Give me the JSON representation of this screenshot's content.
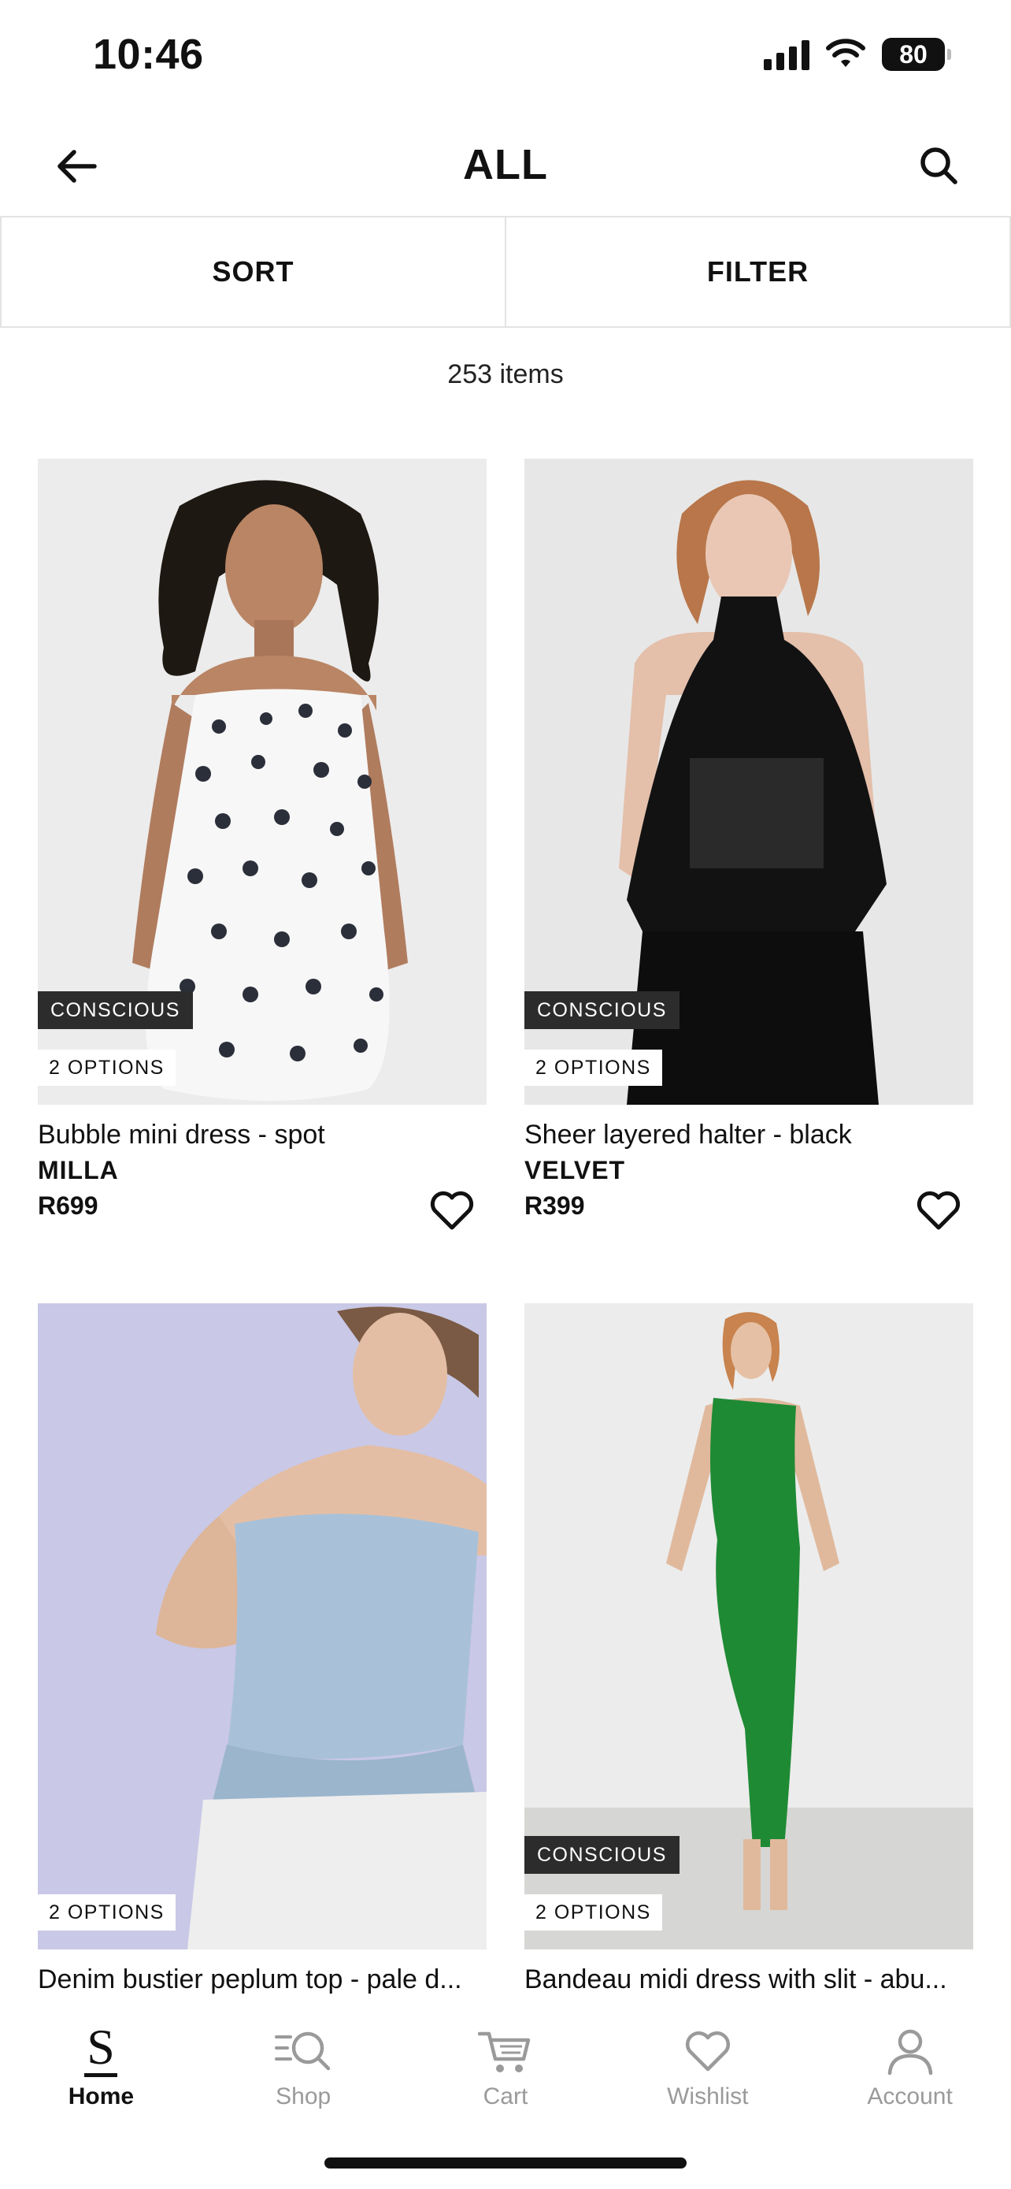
{
  "status_bar": {
    "time": "10:46",
    "battery": "80",
    "icons": [
      "cellular-signal-icon",
      "wifi-icon",
      "battery-icon"
    ]
  },
  "header": {
    "title": "ALL",
    "back_icon": "arrow-left-icon",
    "search_icon": "search-icon"
  },
  "toolbar": {
    "sort_label": "SORT",
    "filter_label": "FILTER"
  },
  "results": {
    "count_text": "253 items"
  },
  "products": [
    {
      "name": "Bubble mini dress - spot",
      "brand": "MILLA",
      "price": "R699",
      "badge": "CONSCIOUS",
      "options": "2 OPTIONS",
      "colors": {
        "background": "#ececec",
        "garment": "#f7f7f7",
        "pattern": "#2b2f3a",
        "skin": "#b98564",
        "hair": "#1e1812"
      }
    },
    {
      "name": "Sheer layered halter - black",
      "brand": "VELVET",
      "price": "R399",
      "badge": "CONSCIOUS",
      "options": "2 OPTIONS",
      "colors": {
        "background": "#e7e7e7",
        "garment": "#121212",
        "skin": "#e9c7b4",
        "hair": "#b8764a"
      }
    },
    {
      "name": "Denim bustier peplum top - pale d...",
      "options": "2 OPTIONS",
      "colors": {
        "background": "#c9c8e6",
        "garment": "#a9c1d8",
        "pants": "#eeeeee",
        "skin": "#e4bea4",
        "hair": "#7a5a44"
      }
    },
    {
      "name": "Bandeau midi dress with slit - abu...",
      "badge": "CONSCIOUS",
      "options": "2 OPTIONS",
      "colors": {
        "background": "#ececec",
        "floor": "#d6d6d4",
        "garment": "#1f8a34",
        "skin": "#e5c0a4",
        "hair": "#c8834e"
      }
    }
  ],
  "bottom_nav": {
    "items": [
      {
        "label": "Home",
        "icon": "store-logo-s-icon",
        "active": true
      },
      {
        "label": "Shop",
        "icon": "shop-search-icon",
        "active": false
      },
      {
        "label": "Cart",
        "icon": "cart-icon",
        "active": false
      },
      {
        "label": "Wishlist",
        "icon": "heart-icon",
        "active": false
      },
      {
        "label": "Account",
        "icon": "user-icon",
        "active": false
      }
    ]
  },
  "colors": {
    "text": "#111111",
    "muted": "#9a9a9a",
    "divider": "#e3e3e3",
    "badge_dark": "#2c2c2c"
  }
}
